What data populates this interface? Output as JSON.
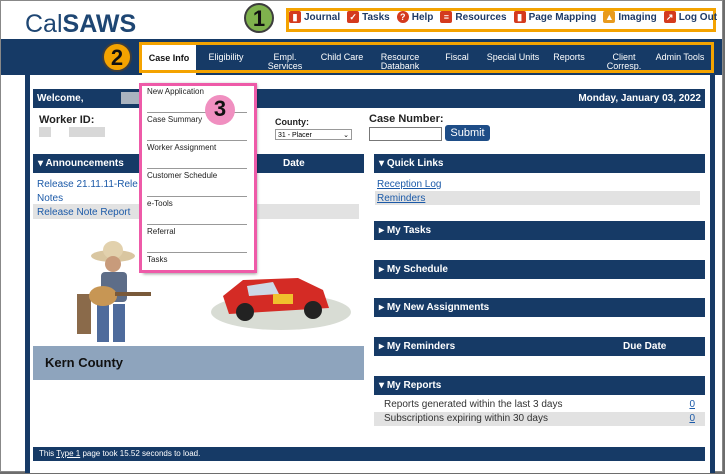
{
  "app": {
    "logo_light": "Cal",
    "logo_bold": "SAWS"
  },
  "badges": {
    "one": "1",
    "two": "2",
    "three": "3"
  },
  "utility": [
    {
      "label": "Journal",
      "icon": "book-icon"
    },
    {
      "label": "Tasks",
      "icon": "check-icon"
    },
    {
      "label": "Help",
      "icon": "help-icon"
    },
    {
      "label": "Resources",
      "icon": "document-icon"
    },
    {
      "label": "Page Mapping",
      "icon": "book-icon"
    },
    {
      "label": "Imaging",
      "icon": "image-icon"
    },
    {
      "label": "Log Out",
      "icon": "logout-icon"
    }
  ],
  "nav": {
    "tabs": [
      {
        "label": "Case Info",
        "active": true
      },
      {
        "label": "Eligibility"
      },
      {
        "label": "Empl. Services"
      },
      {
        "label": "Child Care"
      },
      {
        "label": "Resource Databank"
      },
      {
        "label": "Fiscal"
      },
      {
        "label": "Special Units"
      },
      {
        "label": "Reports"
      },
      {
        "label": "Client Corresp."
      },
      {
        "label": "Admin Tools"
      }
    ]
  },
  "dropdown": {
    "items": [
      "New Application",
      "Case Summary",
      "Worker Assignment",
      "Customer Schedule",
      "e-Tools",
      "Referral",
      "Tasks"
    ]
  },
  "welcome": {
    "label": "Welcome,",
    "date": "Monday, January 03, 2022"
  },
  "worker": {
    "worker_id_label": "Worker ID:",
    "county_label": "County:",
    "county_value": "31 - Placer",
    "case_label": "Case Number:",
    "submit": "Submit"
  },
  "announcements": {
    "title": "Announcements",
    "date_col": "Date",
    "links": [
      "Release 21.11.11-Rele",
      "Notes",
      "Release Note Report"
    ]
  },
  "kern": "Kern County",
  "quick_links": {
    "title": "Quick Links",
    "links": [
      "Reception Log",
      "Reminders"
    ]
  },
  "panels": {
    "my_tasks": "My Tasks",
    "my_schedule": "My Schedule",
    "my_new_assignments": "My New Assignments",
    "my_reminders": "My Reminders",
    "due_date": "Due Date",
    "my_reports": "My Reports"
  },
  "reports": [
    {
      "text": "Reports generated within the last 3 days",
      "count": "0"
    },
    {
      "text": "Subscriptions expiring within 30 days",
      "count": "0"
    }
  ],
  "footer": {
    "prefix": "This ",
    "link": "Type 1",
    "suffix": " page took 15.52 seconds to load."
  },
  "colors": {
    "navy": "#163a66",
    "highlight_orange": "#f4a300",
    "highlight_pink": "#ee5aa8",
    "highlight_green": "#7fb24d"
  }
}
